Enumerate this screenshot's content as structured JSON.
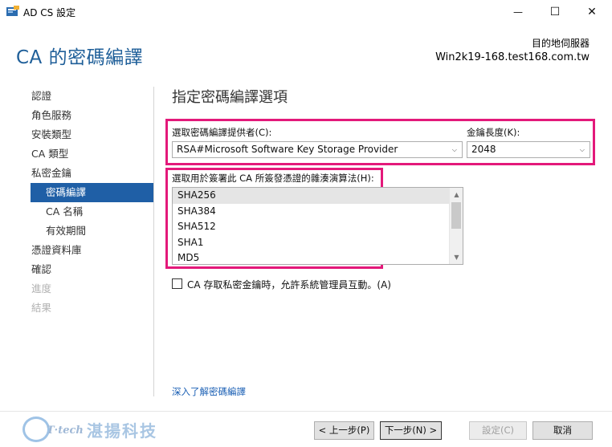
{
  "window": {
    "title": "AD CS 設定",
    "minimize_glyph": "—",
    "maximize_glyph": "☐",
    "close_glyph": "✕"
  },
  "header": {
    "page_title": "CA 的密碼編譯",
    "destination_label": "目的地伺服器",
    "destination_server": "Win2k19-168.test168.com.tw"
  },
  "sidebar": {
    "items": [
      {
        "label": "認證",
        "state": "normal"
      },
      {
        "label": "角色服務",
        "state": "normal"
      },
      {
        "label": "安裝類型",
        "state": "normal"
      },
      {
        "label": "CA 類型",
        "state": "normal"
      },
      {
        "label": "私密金鑰",
        "state": "normal"
      },
      {
        "label": "密碼編譯",
        "state": "active"
      },
      {
        "label": "CA 名稱",
        "state": "sub"
      },
      {
        "label": "有效期間",
        "state": "sub"
      },
      {
        "label": "憑證資料庫",
        "state": "normal"
      },
      {
        "label": "確認",
        "state": "normal"
      },
      {
        "label": "進度",
        "state": "disabled"
      },
      {
        "label": "結果",
        "state": "disabled"
      }
    ]
  },
  "main": {
    "section_title": "指定密碼編譯選項",
    "provider_label": "選取密碼編譯提供者(C):",
    "provider_value": "RSA#Microsoft Software Key Storage Provider",
    "key_length_label": "金鑰長度(K):",
    "key_length_value": "2048",
    "hash_label": "選取用於簽署此 CA 所簽發憑證的雜湊演算法(H):",
    "hash_items": [
      "SHA256",
      "SHA384",
      "SHA512",
      "SHA1",
      "MD5"
    ],
    "hash_selected_index": 0,
    "admin_interaction_label": "CA 存取私密金鑰時，允許系統管理員互動。(A)",
    "admin_interaction_checked": false,
    "learn_more_link": "深入了解密碼編譯",
    "highlight_color": "#e3197a",
    "accent_color": "#1f5fa6"
  },
  "footer": {
    "watermark_text": "湛揚科技",
    "watermark_brand": "T·tech",
    "back_button": "< 上一步(P)",
    "next_button": "下一步(N) >",
    "configure_button": "設定(C)",
    "cancel_button": "取消"
  }
}
